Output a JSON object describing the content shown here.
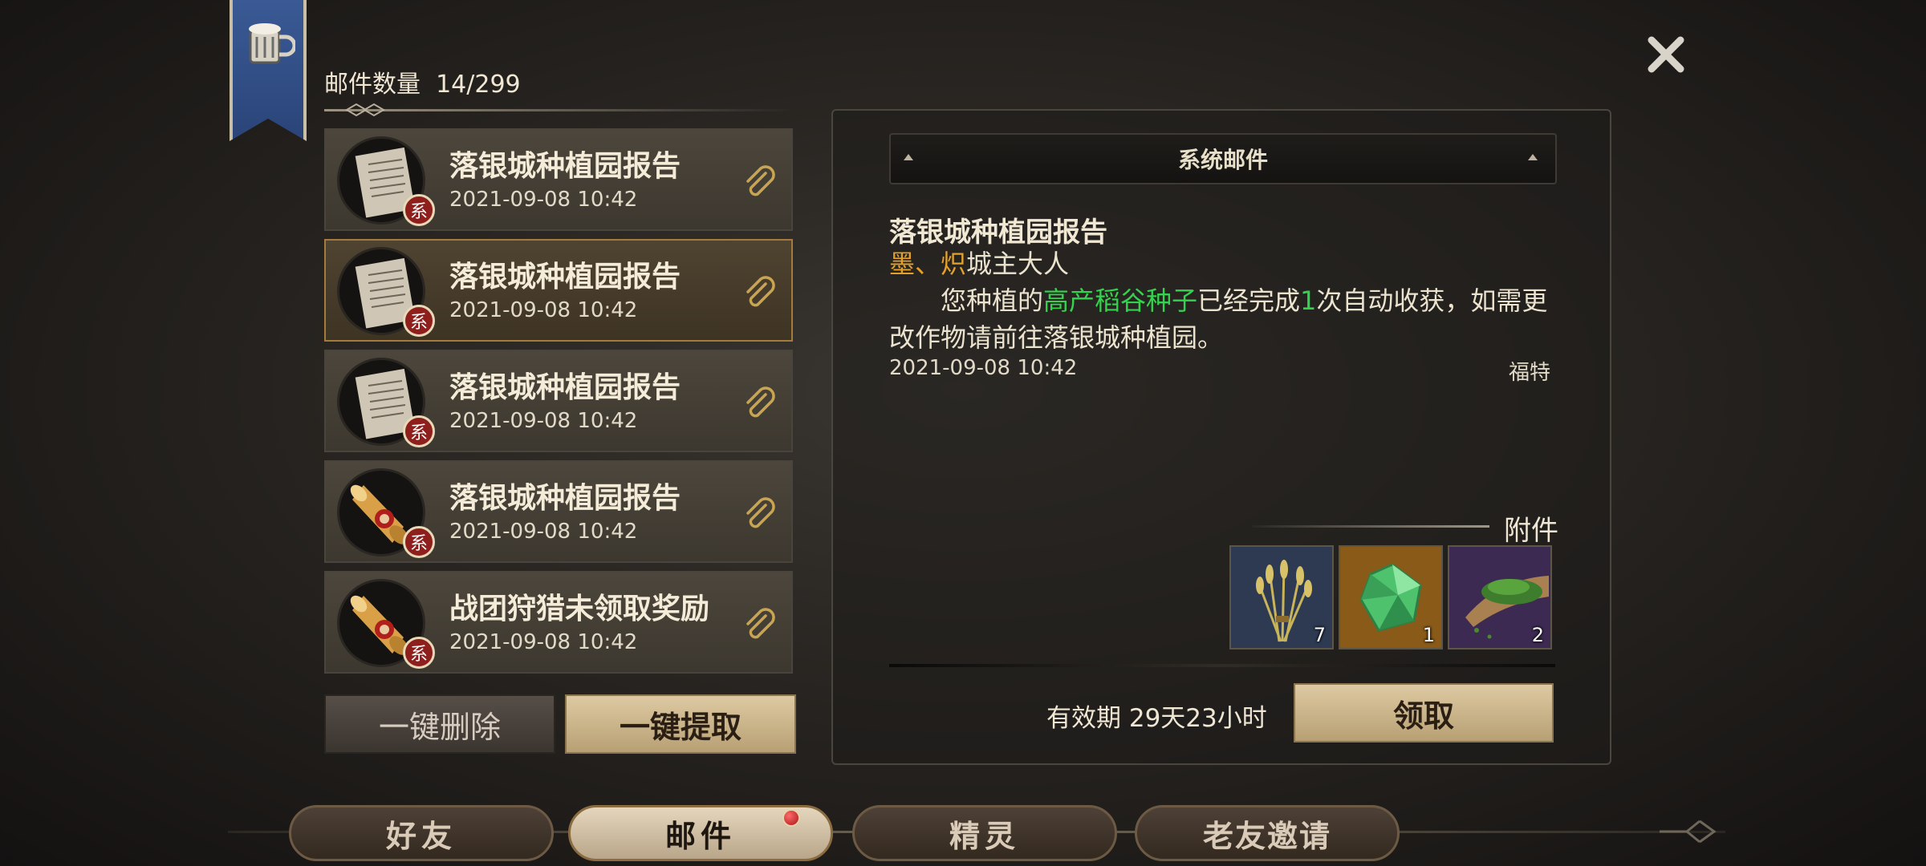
{
  "header": {
    "mail_count_label": "邮件数量",
    "mail_count_value": "14/299",
    "banner_icon": "mug-icon",
    "close_icon": "close-icon"
  },
  "mail_list": {
    "items": [
      {
        "title": "落银城种植园报告",
        "date": "2021-09-08 10:42",
        "badge": "系",
        "icon": "letter-scroll-icon",
        "has_attachment": true,
        "selected": false
      },
      {
        "title": "落银城种植园报告",
        "date": "2021-09-08 10:42",
        "badge": "系",
        "icon": "letter-scroll-icon",
        "has_attachment": true,
        "selected": true
      },
      {
        "title": "落银城种植园报告",
        "date": "2021-09-08 10:42",
        "badge": "系",
        "icon": "letter-scroll-icon",
        "has_attachment": true,
        "selected": false
      },
      {
        "title": "落银城种植园报告",
        "date": "2021-09-08 10:42",
        "badge": "系",
        "icon": "golden-scroll-icon",
        "has_attachment": true,
        "selected": false
      },
      {
        "title": "战团狩猎未领取奖励",
        "date": "2021-09-08 10:42",
        "badge": "系",
        "icon": "golden-scroll-icon",
        "has_attachment": true,
        "selected": false
      }
    ],
    "delete_all_label": "一键删除",
    "collect_all_label": "一键提取"
  },
  "detail": {
    "header_label": "系统邮件",
    "title": "落银城种植园报告",
    "recipient_name": "墨、炽",
    "recipient_suffix": "城主大人",
    "body_part1": "您种植的",
    "body_highlight": "高产稻谷种子",
    "body_part2": "已经完成",
    "body_count": "1",
    "body_part3": "次自动收获，如需更改作物请前往落银城种植园。",
    "date": "2021-09-08 10:42",
    "sender": "福特",
    "attachments_label": "附件",
    "attachments": [
      {
        "icon": "rice-bundle-icon",
        "qty": "7",
        "rarity_color": "#2d3a52"
      },
      {
        "icon": "green-gem-icon",
        "qty": "1",
        "rarity_color": "#8a5a18"
      },
      {
        "icon": "herb-scoop-icon",
        "qty": "2",
        "rarity_color": "#3d2a52"
      }
    ],
    "expire_label": "有效期",
    "expire_value": "29天23小时",
    "claim_label": "领取"
  },
  "tabs": [
    {
      "label": "好友",
      "active": false,
      "has_dot": false
    },
    {
      "label": "邮件",
      "active": true,
      "has_dot": true
    },
    {
      "label": "精灵",
      "active": false,
      "has_dot": false
    },
    {
      "label": "老友邀请",
      "active": false,
      "has_dot": false
    }
  ],
  "colors": {
    "accent_gold": "#e3a12a",
    "highlight_green": "#36d24f",
    "badge_red": "#8e1f1c",
    "selected_border": "#a47b3c"
  }
}
